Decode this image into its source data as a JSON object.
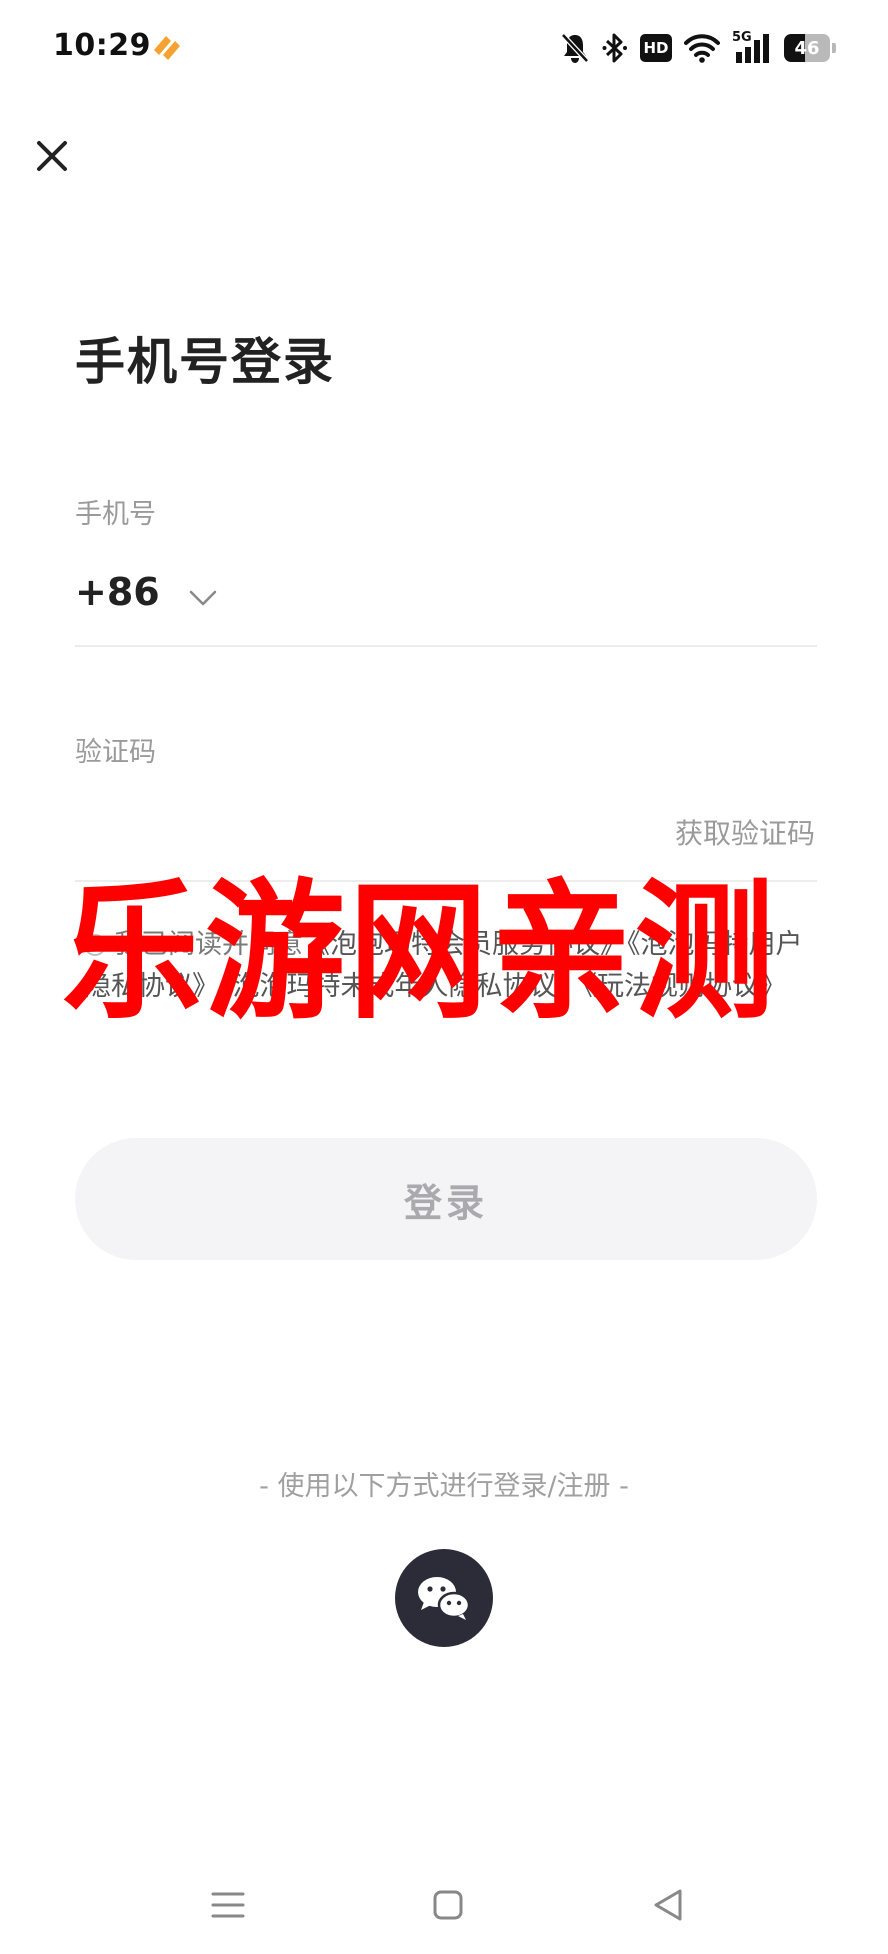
{
  "status_bar": {
    "time": "10:29",
    "battery_level": "46",
    "battery_percent": 46,
    "icons": [
      "app-notification-icon",
      "bell-off-icon",
      "bluetooth-icon",
      "hd-icon",
      "wifi-icon",
      "signal-5g-icon",
      "battery-icon"
    ],
    "hd_label": "HD",
    "network_label": "5G"
  },
  "page": {
    "title": "手机号登录"
  },
  "phone_field": {
    "label": "手机号",
    "country_code": "+86",
    "value": "",
    "placeholder": ""
  },
  "code_field": {
    "label": "验证码",
    "value": "",
    "placeholder": "",
    "get_code_label": "获取验证码"
  },
  "agreement": {
    "prefix": "我已阅读并同意",
    "links": [
      "《泡泡玛特会员服务协议》",
      "《泡泡玛特用户隐私协议》",
      "《泡泡玛特未成年人隐私协议》",
      "《玩法规则协议》"
    ]
  },
  "watermark": {
    "text": "乐游网亲测"
  },
  "login_button": {
    "label": "登录"
  },
  "other_login": {
    "text": "- 使用以下方式进行登录/注册 -",
    "options": [
      "wechat-icon"
    ]
  },
  "colors": {
    "watermark": "#ff0000",
    "button_bg": "#f4f4f7",
    "button_text": "#a9a9ae",
    "wechat_bg": "#2c2b38",
    "muted_text": "#9a9a9a",
    "app_icon": "#f5a230"
  },
  "nav_bar": {
    "buttons": [
      "menu-icon",
      "home-icon",
      "back-icon"
    ]
  }
}
